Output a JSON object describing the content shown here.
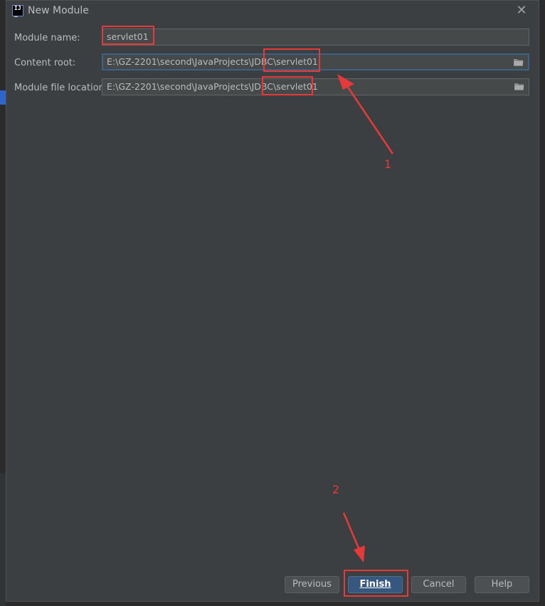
{
  "dialog": {
    "title": "New Module",
    "close_label": "✕"
  },
  "form": {
    "module_name_label": "Module name:",
    "module_name_value": "servlet01",
    "content_root_label": "Content root:",
    "content_root_value": "E:\\GZ-2201\\second\\JavaProjects\\JDBC\\servlet01",
    "module_file_location_label": "Module file location:",
    "module_file_location_value": "E:\\GZ-2201\\second\\JavaProjects\\JDBC\\servlet01"
  },
  "annotations": {
    "step1": "1",
    "step2": "2",
    "color": "#e8393a"
  },
  "buttons": {
    "previous": "Previous",
    "finish": "Finish",
    "cancel": "Cancel",
    "help": "Help"
  },
  "icons": {
    "app": "intellij-icon",
    "folder": "folder-icon",
    "close": "close-icon"
  },
  "colors": {
    "dialog_bg": "#3c3f41",
    "field_bg": "#45494a",
    "focus_border": "#3d6185",
    "default_button": "#365880"
  }
}
